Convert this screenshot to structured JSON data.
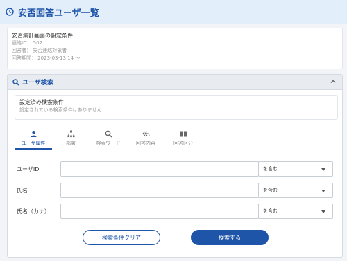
{
  "header": {
    "title": "安否回答ユーザ一覧"
  },
  "conditions": {
    "heading": "安否集計画面の設定条件",
    "lines": [
      "連絡ID： 502",
      "回答者： 安否連絡対象者",
      "回答期間： 2023-03-13 14 ～"
    ]
  },
  "search": {
    "title": "ユーザ検索",
    "set_heading": "設定済み検索条件",
    "set_empty": "設定されている検索条件はありません",
    "tabs": [
      {
        "label": "ユーザ属性",
        "icon": "person-icon",
        "active": true
      },
      {
        "label": "部署",
        "icon": "org-chart-icon",
        "active": false
      },
      {
        "label": "検索ワード",
        "icon": "search-icon",
        "active": false
      },
      {
        "label": "回答内容",
        "icon": "reply-all-icon",
        "active": false
      },
      {
        "label": "回答区分",
        "icon": "grid-icon",
        "active": false
      }
    ],
    "fields": [
      {
        "label": "ユーザID",
        "value": "",
        "match": "を含む"
      },
      {
        "label": "氏名",
        "value": "",
        "match": "を含む"
      },
      {
        "label": "氏名（カナ）",
        "value": "",
        "match": "を含む"
      }
    ],
    "clear_label": "検索条件クリア",
    "search_label": "検索する"
  },
  "colors": {
    "accent": "#1f55a8",
    "header_bg": "#e3eefb"
  }
}
